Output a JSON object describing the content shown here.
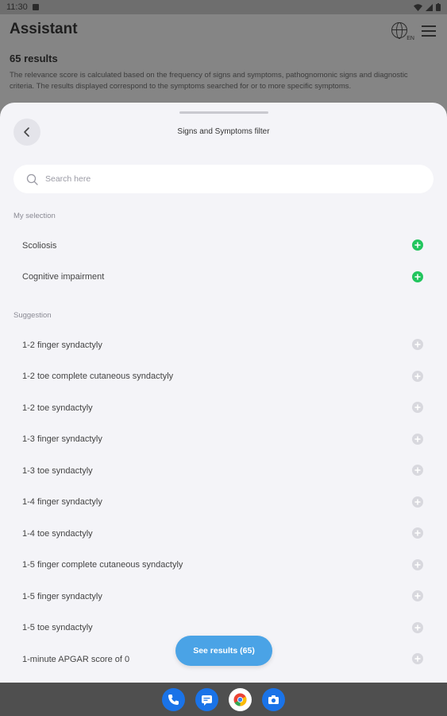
{
  "status_bar": {
    "time": "11:30"
  },
  "background": {
    "title": "Assistant",
    "globe_badge": "EN",
    "results_count": "65 results",
    "description": "The relevance score is calculated based on the frequency of signs and symptoms, pathognomonic signs and diagnostic criteria. The results displayed correspond to the symptoms searched for or to more specific symptoms."
  },
  "sheet": {
    "title": "Signs and Symptoms filter",
    "search": {
      "placeholder": "Search here",
      "value": ""
    },
    "my_selection_label": "My selection",
    "my_selection": [
      {
        "label": "Scoliosis"
      },
      {
        "label": "Cognitive impairment"
      }
    ],
    "suggestion_label": "Suggestion",
    "suggestions": [
      {
        "label": "1-2 finger syndactyly"
      },
      {
        "label": "1-2 toe complete cutaneous syndactyly"
      },
      {
        "label": "1-2 toe syndactyly"
      },
      {
        "label": "1-3 finger syndactyly"
      },
      {
        "label": "1-3 toe syndactyly"
      },
      {
        "label": "1-4 finger syndactyly"
      },
      {
        "label": "1-4 toe syndactyly"
      },
      {
        "label": "1-5 finger complete cutaneous syndactyly"
      },
      {
        "label": "1-5 finger syndactyly"
      },
      {
        "label": "1-5 toe syndactyly"
      },
      {
        "label": "1-minute APGAR score of 0"
      }
    ],
    "cta_label": "See results (65)"
  },
  "colors": {
    "accent": "#4aa3e6",
    "selected": "#22c55e",
    "suggestion_icon": "#d8d8de",
    "sheet_bg": "#f4f4f8"
  },
  "icons": {
    "back": "chevron-left-icon",
    "search": "search-icon",
    "selected_item": "plus-circle-icon",
    "suggestion_item": "plus-circle-icon",
    "dock": [
      "phone-icon",
      "messages-icon",
      "chrome-icon",
      "camera-icon"
    ]
  }
}
